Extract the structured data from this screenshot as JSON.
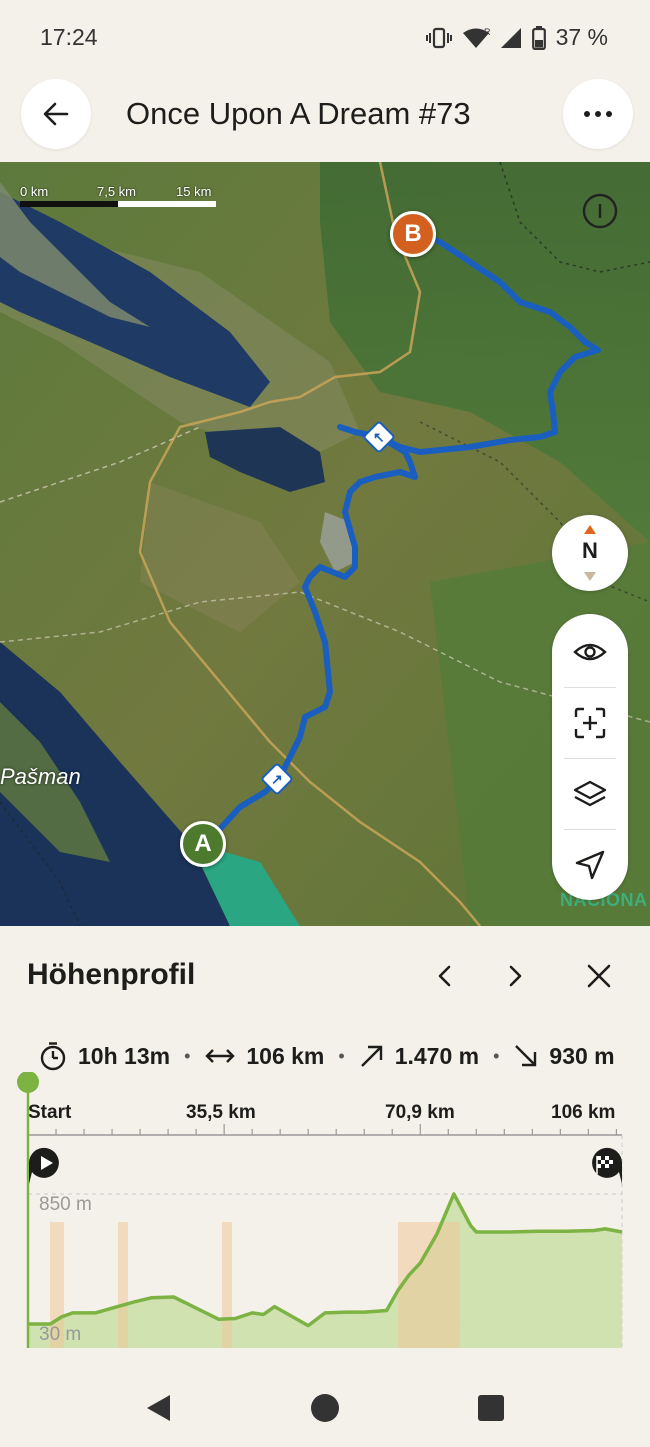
{
  "status_bar": {
    "time": "17:24",
    "battery": "37 %",
    "icons": [
      "vibrate-icon",
      "wifi-icon",
      "signal-icon",
      "battery-icon"
    ]
  },
  "header": {
    "title": "Once Upon A Dream #73",
    "back_icon": "arrow-left-icon",
    "more_icon": "more-horizontal-icon"
  },
  "map": {
    "scale": {
      "labels": [
        "0 km",
        "7,5 km",
        "15 km"
      ]
    },
    "markers": {
      "start": "A",
      "end": "B"
    },
    "place_label": "Pašman",
    "park_label": "NACIONA",
    "compass_label": "N",
    "tools": [
      "eye-icon",
      "focus-plus-icon",
      "layers-icon",
      "navigation-arrow-icon"
    ],
    "colors": {
      "route": "#1a5fbf",
      "start_marker": "#4e7a2d",
      "end_marker": "#d3601f"
    }
  },
  "panel": {
    "title": "Höhenprofil",
    "stats": {
      "duration": "10h 13m",
      "distance": "106 km",
      "ascent": "1.470 m",
      "descent": "930 m"
    },
    "axis": {
      "labels": [
        "Start",
        "35,5 km",
        "70,9 km",
        "106 km"
      ]
    },
    "elevation": {
      "max_label": "850 m",
      "min_label": "30 m"
    }
  },
  "chart_data": {
    "type": "area",
    "x_unit": "km",
    "y_unit": "m",
    "xlim": [
      0,
      106
    ],
    "ylim": [
      30,
      850
    ],
    "x": [
      0,
      4,
      6,
      8,
      12,
      16,
      19,
      22,
      26,
      30,
      34,
      37,
      40,
      42,
      44,
      47,
      50,
      53,
      57,
      60,
      64,
      66,
      68,
      70,
      73,
      76,
      79,
      80,
      82,
      86,
      91,
      96,
      101,
      103,
      106
    ],
    "y": [
      30,
      30,
      75,
      100,
      100,
      140,
      170,
      195,
      200,
      130,
      60,
      65,
      100,
      90,
      140,
      80,
      20,
      100,
      105,
      105,
      115,
      240,
      340,
      415,
      600,
      850,
      650,
      610,
      610,
      610,
      615,
      615,
      620,
      630,
      610
    ]
  },
  "system_nav": {
    "icons": [
      "back-triangle-icon",
      "home-circle-icon",
      "recents-square-icon"
    ]
  }
}
